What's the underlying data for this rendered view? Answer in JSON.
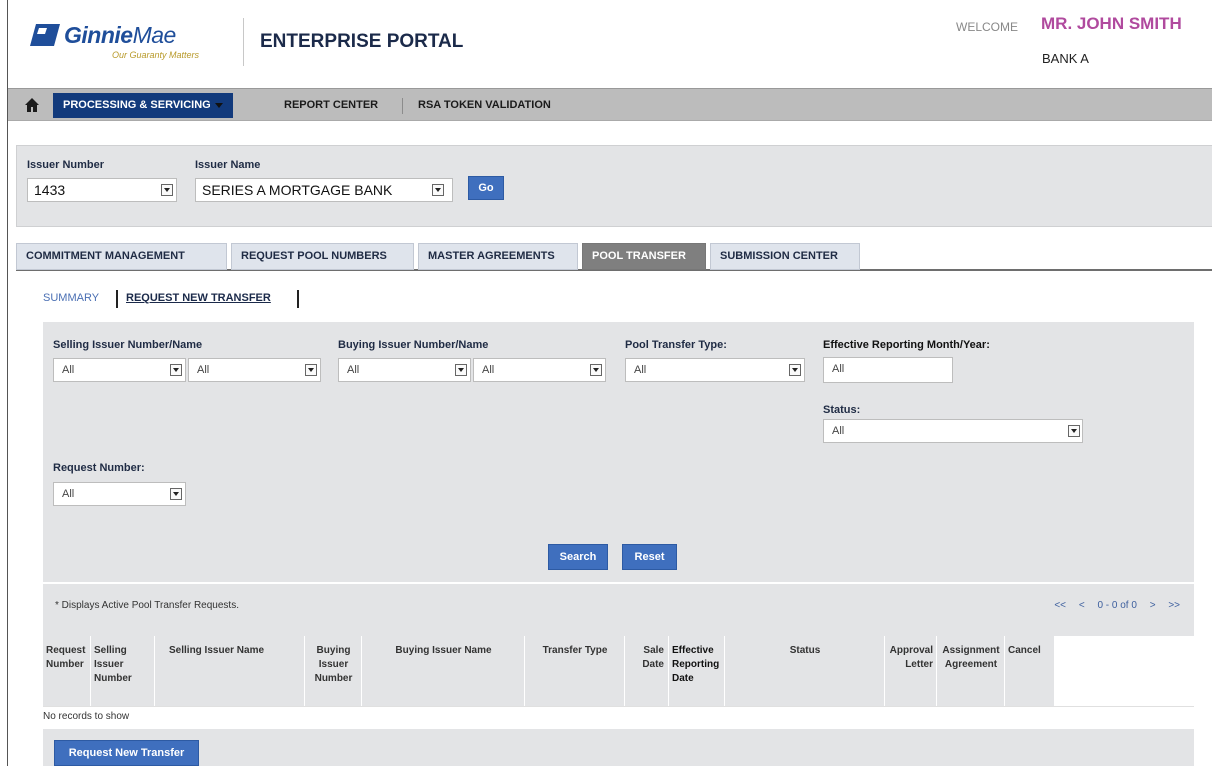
{
  "header": {
    "logo_main": "Ginnie",
    "logo_thin": "Mae",
    "logo_tagline": "Our Guaranty Matters",
    "portal_title": "ENTERPRISE PORTAL",
    "welcome": "WELCOME",
    "user_name": "MR. JOHN SMITH",
    "bank": "BANK A"
  },
  "nav": {
    "items": [
      {
        "label": "PROCESSING & SERVICING"
      },
      {
        "label": "REPORT CENTER"
      },
      {
        "label": "RSA TOKEN VALIDATION"
      }
    ]
  },
  "issuer": {
    "number_label": "Issuer Number",
    "number_value": "1433",
    "name_label": "Issuer Name",
    "name_value": "SERIES A MORTGAGE BANK",
    "go_label": "Go"
  },
  "module_tabs": [
    {
      "label": "COMMITMENT MANAGEMENT"
    },
    {
      "label": "REQUEST POOL NUMBERS"
    },
    {
      "label": "MASTER AGREEMENTS"
    },
    {
      "label": "POOL TRANSFER"
    },
    {
      "label": "SUBMISSION CENTER"
    }
  ],
  "subtabs": {
    "summary": "SUMMARY",
    "request_new": "REQUEST NEW TRANSFER"
  },
  "filters": {
    "selling_label": "Selling Issuer Number/Name",
    "selling_number": "All",
    "selling_name": "All",
    "buying_label": "Buying Issuer Number/Name",
    "buying_number": "All",
    "buying_name": "All",
    "type_label": "Pool Transfer Type:",
    "type_value": "All",
    "effective_label": "Effective Reporting Month/Year:",
    "effective_value": "All",
    "status_label": "Status:",
    "status_value": "All",
    "request_label": "Request Number:",
    "request_value": "All",
    "search_label": "Search",
    "reset_label": "Reset"
  },
  "results": {
    "note": "* Displays Active Pool Transfer Requests.",
    "pager_first": "<<",
    "pager_prev": "<",
    "pager_info": "0 - 0 of 0",
    "pager_next": ">",
    "pager_last": ">>",
    "no_records": "No records to show",
    "request_new_button": "Request New Transfer"
  },
  "columns": [
    {
      "label": "Request Number"
    },
    {
      "label": "Selling Issuer Number"
    },
    {
      "label": "Selling Issuer Name"
    },
    {
      "label": "Buying Issuer Number"
    },
    {
      "label": "Buying Issuer Name"
    },
    {
      "label": "Transfer Type"
    },
    {
      "label": "Sale Date"
    },
    {
      "label": "Effective Reporting Date"
    },
    {
      "label": "Status"
    },
    {
      "label": "Approval Letter"
    },
    {
      "label": "Assignment Agreement"
    },
    {
      "label": "Cancel"
    }
  ],
  "colors": {
    "nav_active": "#123a7c",
    "button": "#3f6fbe",
    "user_name": "#b04a9e",
    "panel": "#e3e4e6"
  }
}
